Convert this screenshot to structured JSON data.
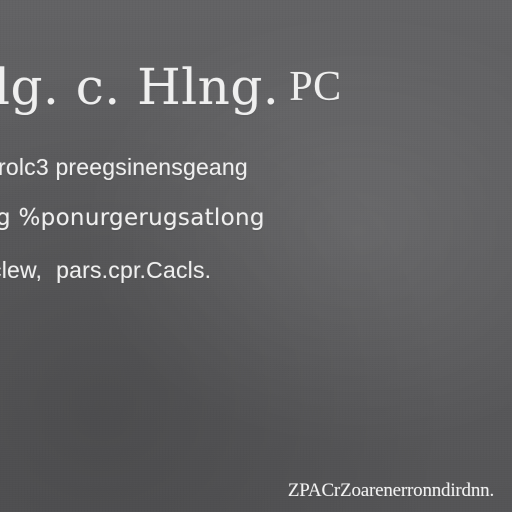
{
  "content": {
    "title_main": "lg. c. Hlng.",
    "title_accent": "PC",
    "line_2": "rolc3 preegsinensgeang",
    "line_3": "g %ponurgerugsatlong",
    "line_4_part_1": "clew,",
    "line_4_part_2": "pars.cpr.Cacls.",
    "footer": "ZPACrZoarenerronndirdnn."
  },
  "colors": {
    "background": "#5d5d5f",
    "text": "#efefef"
  }
}
